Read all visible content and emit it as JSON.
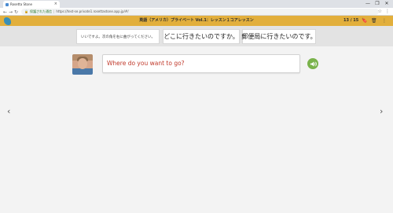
{
  "browser": {
    "tab_title": "Rosetta Stone",
    "tab_close": "×",
    "security_label": "保護された通信",
    "url": "https://test-se.private1.rosettastone.app.jp/#/",
    "window_controls": [
      "—",
      "❐",
      "✕"
    ]
  },
  "header": {
    "title": "英語（アメリカ）プライベート Vol.1：レッスン１コアレッスン",
    "progress": "13 / 15"
  },
  "word_chips": [
    "いいですよ。次の角を右に曲がってください。",
    "どこに行きたいのですか。",
    "郵便局に行きたいのです。"
  ],
  "answer": {
    "text": "Where do you want to go?",
    "color": "#c0392b"
  },
  "nav": {
    "prev": "‹",
    "next": "›"
  },
  "colors": {
    "header_bg": "#e2af3c",
    "band_bg": "#e3e3e3",
    "audio_green": "#79b24a"
  }
}
